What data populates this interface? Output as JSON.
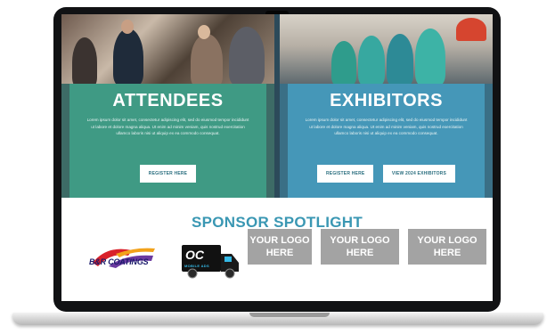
{
  "attendees": {
    "title": "ATTENDEES",
    "body": "Lorem ipsum dolor sit amet, consectetur adipiscing elit, sed do eiusmod tempor incididunt ut labore et dolore magna aliqua. Ut enim ad minim veniam, quis nostrud exercitation ullamco laboris nisi ut aliquip ex ea commodo consequat.",
    "register_label": "REGISTER HERE"
  },
  "exhibitors": {
    "title": "EXHIBITORS",
    "body": "Lorem ipsum dolor sit amet, consectetur adipiscing elit, sed do eiusmod tempor incididunt ut labore et dolore magna aliqua. Ut enim ad minim veniam, quis nostrud exercitation ullamco laboris nisi ut aliquip ex ea commodo consequat.",
    "register_label": "REGISTER HERE",
    "view_label": "VIEW 2024 EXHIBITORS"
  },
  "sponsor": {
    "title": "SPONSOR SPOTLIGHT",
    "logos": [
      {
        "text": "B&R COATINGS"
      },
      {
        "text": "OC",
        "subtext": "MOBILE ADS"
      },
      {
        "text": "YOUR LOGO HERE"
      },
      {
        "text": "YOUR LOGO HERE"
      },
      {
        "text": "YOUR LOGO HERE"
      }
    ]
  },
  "colors": {
    "attendees_box": "#3f9a84",
    "exhibitors_box": "#4597b8",
    "sponsor_title": "#3a97b3",
    "placeholder_logo": "#a3a3a3"
  }
}
